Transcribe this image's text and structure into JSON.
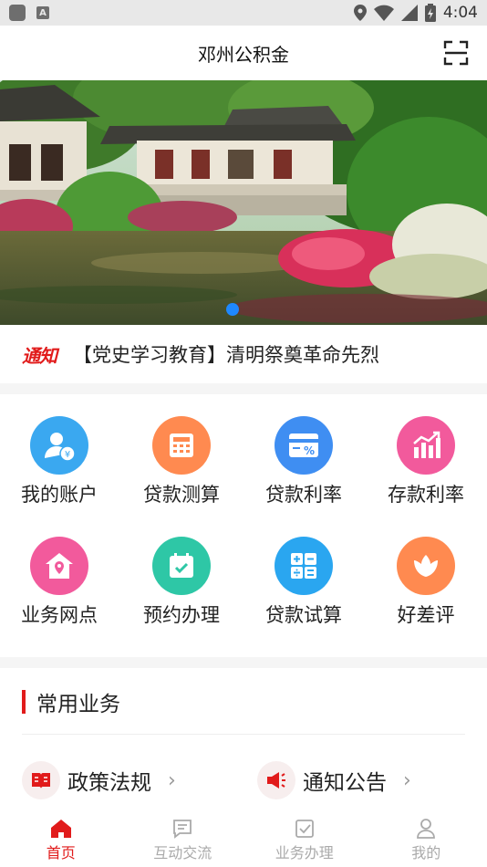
{
  "status_bar": {
    "time": "4:04"
  },
  "header": {
    "title": "邓州公积金"
  },
  "notice": {
    "tag": "通知",
    "text": "【党史学习教育】清明祭奠革命先烈"
  },
  "quick_grid": [
    {
      "label": "我的账户",
      "icon": "account-icon",
      "color": "#3aa8f0"
    },
    {
      "label": "贷款测算",
      "icon": "calculator-icon",
      "color": "#ff8a50"
    },
    {
      "label": "贷款利率",
      "icon": "rate-card-icon",
      "color": "#3f8ef2"
    },
    {
      "label": "存款利率",
      "icon": "chart-up-icon",
      "color": "#f25a9c"
    },
    {
      "label": "业务网点",
      "icon": "location-house-icon",
      "color": "#f25a9c"
    },
    {
      "label": "预约办理",
      "icon": "calendar-check-icon",
      "color": "#2ec7a6"
    },
    {
      "label": "贷款试算",
      "icon": "math-calc-icon",
      "color": "#2aa6f0"
    },
    {
      "label": "好差评",
      "icon": "tulip-icon",
      "color": "#ff8a50"
    }
  ],
  "common_services": {
    "title": "常用业务",
    "items": [
      {
        "label": "政策法规",
        "icon": "policy-book-icon",
        "arrow": "›"
      },
      {
        "label": "通知公告",
        "icon": "megaphone-icon",
        "arrow": "›"
      }
    ]
  },
  "tabbar": {
    "active_color": "#e11b1b",
    "inactive_color": "#aaaaaa",
    "tabs": [
      {
        "label": "首页",
        "icon": "home-icon",
        "active": true
      },
      {
        "label": "互动交流",
        "icon": "chat-icon",
        "active": false
      },
      {
        "label": "业务办理",
        "icon": "task-check-icon",
        "active": false
      },
      {
        "label": "我的",
        "icon": "user-icon",
        "active": false
      }
    ]
  }
}
